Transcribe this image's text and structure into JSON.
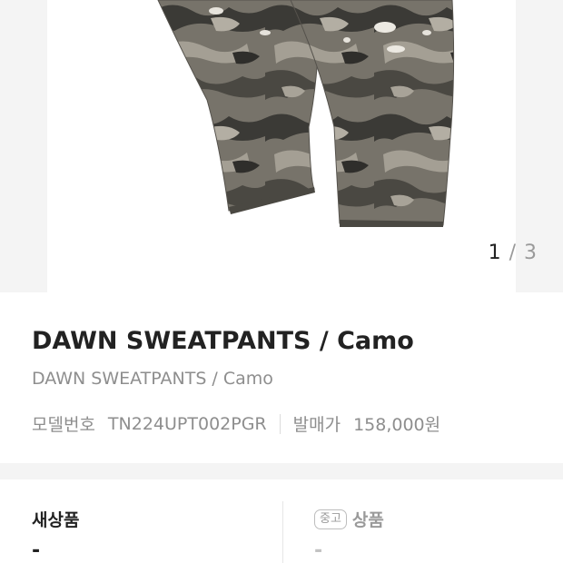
{
  "gallery": {
    "image_alt": "camo sweatpants",
    "pager_current": "1",
    "pager_separator": "/",
    "pager_total": "3"
  },
  "product": {
    "title": "DAWN SWEATPANTS / Camo",
    "subtitle": "DAWN SWEATPANTS / Camo",
    "model_label": "모델번호",
    "model_number": "TN224UPT002PGR",
    "release_price_label": "발매가",
    "release_price": "158,000원"
  },
  "conditions": {
    "new_label": "새상품",
    "new_value": "-",
    "used_badge": "중고",
    "used_label": "상품",
    "used_value": "-"
  },
  "colors": {
    "camo_dark": "#3a3935",
    "camo_mid": "#6f6b63",
    "camo_light": "#a39e93",
    "gallery_bg": "#f4f4f4"
  }
}
